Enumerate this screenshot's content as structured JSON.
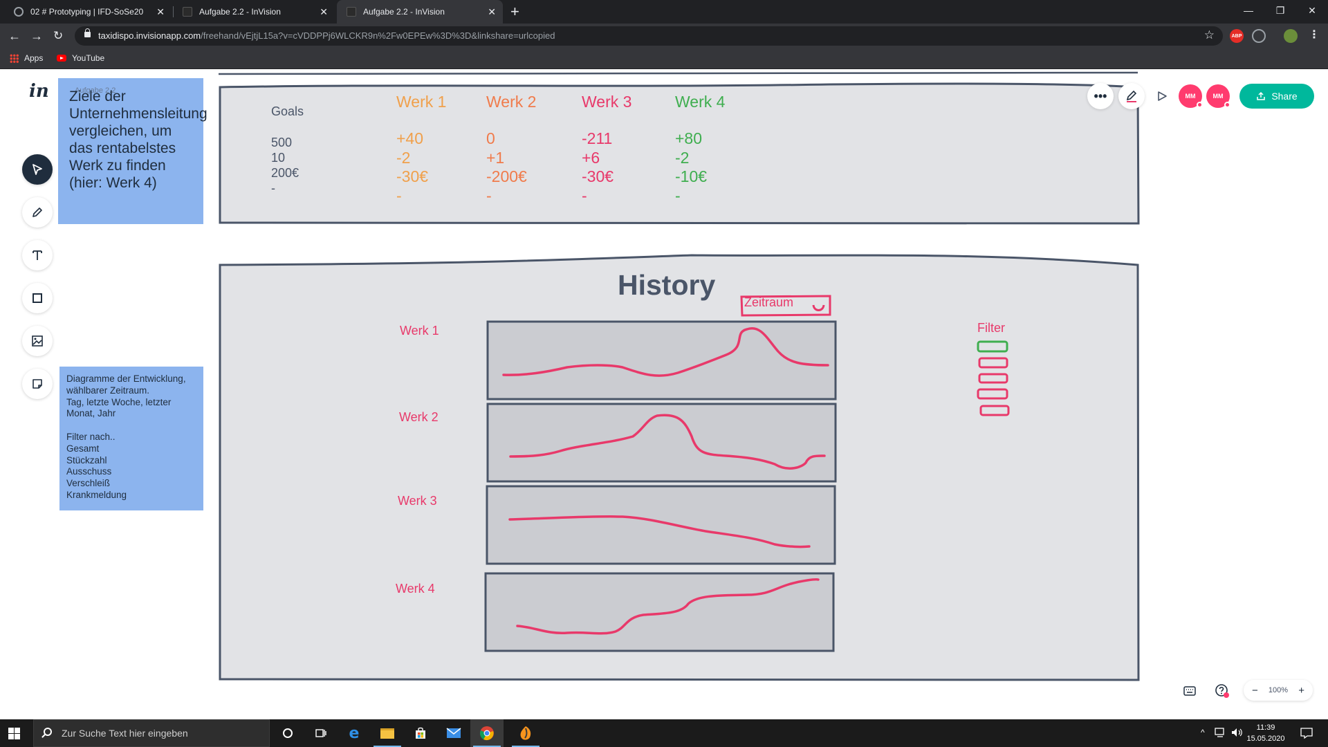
{
  "browser": {
    "tabs": [
      {
        "label": "02 # Prototyping | IFD-SoSe20",
        "active": false
      },
      {
        "label": "Aufgabe 2.2 - InVision",
        "active": false
      },
      {
        "label": "Aufgabe 2.2 - InVision",
        "active": true
      }
    ],
    "url_host": "taxidispo.invisionapp.com",
    "url_path": "/freehand/vEjtjL15a?v=cVDDPPj6WLCKR9n%2Fw0EPEw%3D%3D&linkshare=urlcopied",
    "bookmarks": [
      {
        "label": "Apps",
        "icon": "apps-grid-icon"
      },
      {
        "label": "YouTube",
        "icon": "youtube-icon"
      }
    ],
    "extensions": [
      {
        "name": "adblock-icon",
        "label": "ABP",
        "color": "#e52d27"
      },
      {
        "name": "extension-icon",
        "label": "",
        "color": "#5f6368"
      }
    ]
  },
  "app": {
    "logo": "in",
    "tools": [
      "select-tool-icon",
      "pen-tool-icon",
      "text-tool-icon",
      "shape-tool-icon",
      "image-tool-icon",
      "sticky-note-tool-icon"
    ],
    "top_right": {
      "avatars": [
        {
          "initials": "MM",
          "color": "#ff3b6e"
        },
        {
          "initials": "MM",
          "color": "#ff3b6e"
        }
      ],
      "share_label": "Share",
      "share_color": "#00b89c"
    },
    "zoom": {
      "minus": "−",
      "level": "100%",
      "plus": "+"
    }
  },
  "board": {
    "sticky_top": {
      "faded_title": "Aufgabe 2.2",
      "text": "Ziele der\nUnternehmensleitung\nvergleichen, um\ndas rentabelstes\nWerk zu finden\n(hier: Werk 4)"
    },
    "sticky_bottom": {
      "text": "Diagramme der Entwicklung,\nwählbarer Zeitraum.\nTag, letzte Woche, letzter\nMonat, Jahr\n\nFilter nach..\nGesamt\nStückzahl\nAusschuss\nVerschleiß\nKrankmeldung"
    },
    "goals": {
      "label": "Goals",
      "values": "500\n10\n200€\n-"
    },
    "werke": [
      {
        "name": "Werk 1",
        "values": "+40\n-2\n-30€\n-",
        "color": "#f0a04b"
      },
      {
        "name": "Werk 2",
        "values": "0\n+1\n-200€\n-",
        "color": "#f07b4b"
      },
      {
        "name": "Werk 3",
        "values": "-211\n+6\n-30€\n-",
        "color": "#e8396a"
      },
      {
        "name": "Werk 4",
        "values": "+80\n-2\n-10€\n-",
        "color": "#3fae4f"
      }
    ],
    "history": {
      "title": "History",
      "zeitraum": "Zeitraum",
      "filter_label": "Filter",
      "rows": [
        "Werk 1",
        "Werk 2",
        "Werk 3",
        "Werk 4"
      ]
    }
  },
  "taskbar": {
    "search_placeholder": "Zur Suche Text hier eingeben",
    "apps": [
      "cortana-icon",
      "task-view-icon",
      "edge-icon",
      "file-explorer-icon",
      "store-icon",
      "mail-icon",
      "chrome-icon",
      "fl-studio-icon"
    ],
    "time": "11:39",
    "date": "15.05.2020"
  },
  "colors": {
    "accent_red": "#e8396a",
    "board_fill": "#e2e3e6",
    "chart_fill": "#cbccd1",
    "ink": "#4a5568",
    "sticky_blue": "#8cb4ee"
  }
}
